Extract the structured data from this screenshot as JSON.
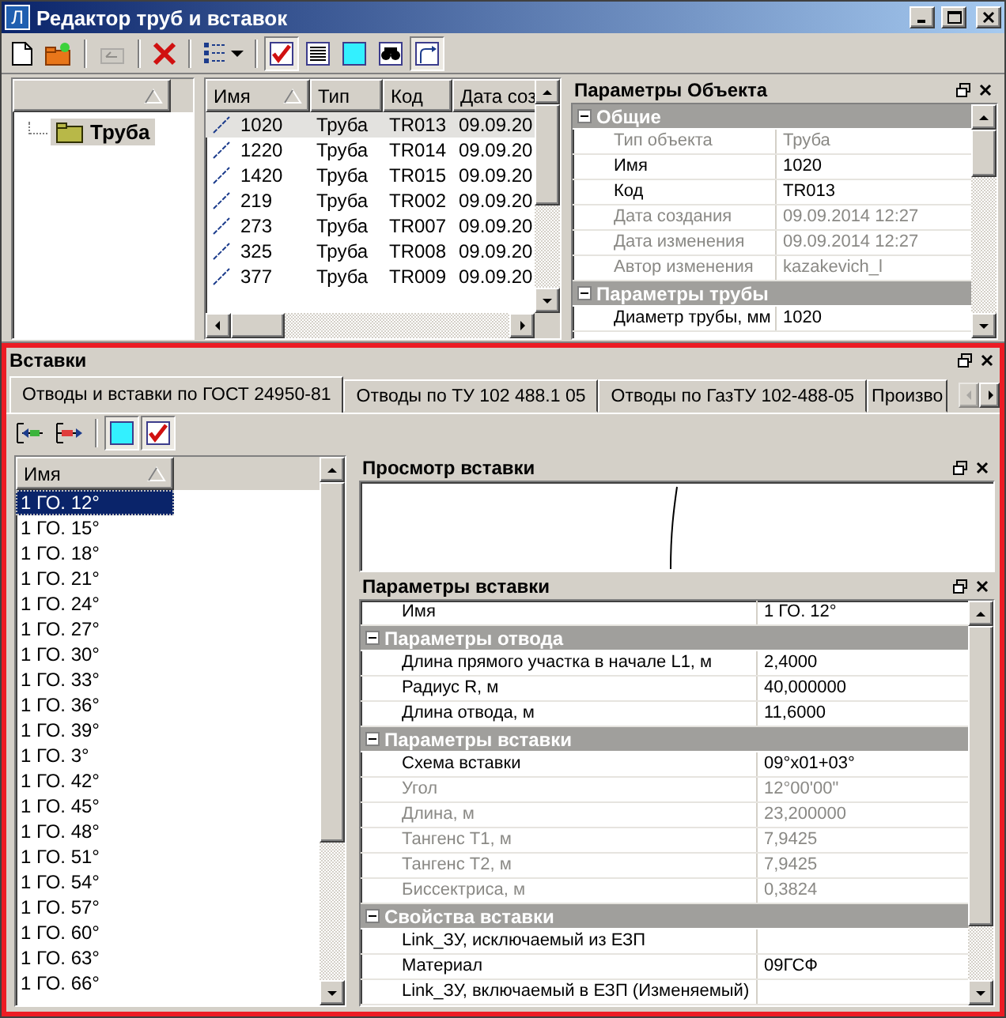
{
  "window": {
    "logo": "Л",
    "title": "Редактор труб и вставок"
  },
  "toolbar": [
    {
      "kind": "button",
      "pressed": false,
      "disabled": false
    },
    {
      "kind": "button",
      "pressed": false,
      "disabled": false
    },
    {
      "kind": "separator"
    },
    {
      "kind": "button",
      "pressed": false,
      "disabled": true
    },
    {
      "kind": "separator"
    },
    {
      "kind": "button",
      "pressed": false,
      "disabled": false
    },
    {
      "kind": "separator"
    },
    {
      "kind": "dropdown",
      "pressed": false,
      "disabled": false
    },
    {
      "kind": "separator"
    },
    {
      "kind": "button",
      "pressed": true,
      "disabled": false
    },
    {
      "kind": "button",
      "pressed": false,
      "disabled": false
    },
    {
      "kind": "button",
      "pressed": false,
      "disabled": false
    },
    {
      "kind": "button",
      "pressed": false,
      "disabled": false
    },
    {
      "kind": "button",
      "pressed": true,
      "disabled": false
    }
  ],
  "tree": {
    "items": [
      {
        "label": "Труба",
        "selected": true
      }
    ]
  },
  "pipes": {
    "columns": [
      "Имя",
      "Тип",
      "Код",
      "Дата соз"
    ],
    "rows": [
      {
        "cells": [
          "1020",
          "Труба",
          "TR013",
          "09.09.20"
        ],
        "selected": true
      },
      {
        "cells": [
          "1220",
          "Труба",
          "TR014",
          "09.09.20"
        ],
        "selected": false
      },
      {
        "cells": [
          "1420",
          "Труба",
          "TR015",
          "09.09.20"
        ],
        "selected": false
      },
      {
        "cells": [
          "219",
          "Труба",
          "TR002",
          "09.09.20"
        ],
        "selected": false
      },
      {
        "cells": [
          "273",
          "Труба",
          "TR007",
          "09.09.20"
        ],
        "selected": false
      },
      {
        "cells": [
          "325",
          "Труба",
          "TR008",
          "09.09.20"
        ],
        "selected": false
      },
      {
        "cells": [
          "377",
          "Труба",
          "TR009",
          "09.09.20"
        ],
        "selected": false
      }
    ]
  },
  "object_params": {
    "title": "Параметры Объекта",
    "groups": [
      {
        "title": "Общие",
        "expanded": true,
        "rows": [
          {
            "name": "Тип объекта",
            "value": "Труба",
            "disabled": true
          },
          {
            "name": "Имя",
            "value": "1020",
            "disabled": false
          },
          {
            "name": "Код",
            "value": "TR013",
            "disabled": false
          },
          {
            "name": "Дата создания",
            "value": "09.09.2014 12:27",
            "disabled": true
          },
          {
            "name": "Дата изменения",
            "value": "09.09.2014 12:27",
            "disabled": true
          },
          {
            "name": "Автор изменения",
            "value": "kazakevich_l",
            "disabled": true
          }
        ]
      },
      {
        "title": "Параметры трубы",
        "expanded": true,
        "rows": [
          {
            "name": "Диаметр трубы, мм",
            "value": "1020",
            "disabled": false
          }
        ]
      }
    ]
  },
  "inserts": {
    "title": "Вставки",
    "tabs": [
      {
        "label": "Отводы и вставки по ГОСТ 24950-81",
        "selected": true
      },
      {
        "label": "Отводы по ТУ 102 488.1 05",
        "selected": false
      },
      {
        "label": "Отводы по ГазТУ 102-488-05",
        "selected": false
      },
      {
        "label": "Произво",
        "selected": false
      }
    ],
    "toolbar": [
      {
        "kind": "button",
        "pressed": false,
        "disabled": false
      },
      {
        "kind": "button",
        "pressed": false,
        "disabled": false
      },
      {
        "kind": "separator"
      },
      {
        "kind": "button",
        "pressed": true,
        "disabled": false
      },
      {
        "kind": "button",
        "pressed": true,
        "disabled": false
      }
    ],
    "list": {
      "column": "Имя",
      "items": [
        {
          "label": "1 ГО. 12°",
          "selected": true
        },
        {
          "label": "1 ГО. 15°",
          "selected": false
        },
        {
          "label": "1 ГО. 18°",
          "selected": false
        },
        {
          "label": "1 ГО. 21°",
          "selected": false
        },
        {
          "label": "1 ГО. 24°",
          "selected": false
        },
        {
          "label": "1 ГО. 27°",
          "selected": false
        },
        {
          "label": "1 ГО. 30°",
          "selected": false
        },
        {
          "label": "1 ГО. 33°",
          "selected": false
        },
        {
          "label": "1 ГО. 36°",
          "selected": false
        },
        {
          "label": "1 ГО. 39°",
          "selected": false
        },
        {
          "label": "1 ГО. 3°",
          "selected": false
        },
        {
          "label": "1 ГО. 42°",
          "selected": false
        },
        {
          "label": "1 ГО. 45°",
          "selected": false
        },
        {
          "label": "1 ГО. 48°",
          "selected": false
        },
        {
          "label": "1 ГО. 51°",
          "selected": false
        },
        {
          "label": "1 ГО. 54°",
          "selected": false
        },
        {
          "label": "1 ГО. 57°",
          "selected": false
        },
        {
          "label": "1 ГО. 60°",
          "selected": false
        },
        {
          "label": "1 ГО. 63°",
          "selected": false
        },
        {
          "label": "1 ГО. 66°",
          "selected": false
        }
      ]
    },
    "preview": {
      "title": "Просмотр вставки"
    },
    "params": {
      "title": "Параметры вставки",
      "rows": [
        {
          "name": "Имя",
          "value": "1 ГО. 12°",
          "disabled": false
        }
      ],
      "groups": [
        {
          "title": "Параметры отвода",
          "expanded": true,
          "rows": [
            {
              "name": "Длина прямого участка в начале L1, м",
              "value": "2,4000",
              "disabled": false
            },
            {
              "name": "Радиус R, м",
              "value": "40,000000",
              "disabled": false
            },
            {
              "name": "Длина отвода, м",
              "value": "11,6000",
              "disabled": false
            }
          ]
        },
        {
          "title": "Параметры вставки",
          "expanded": true,
          "rows": [
            {
              "name": "Схема вставки",
              "value": "09°x01+03°",
              "disabled": false
            },
            {
              "name": "Угол",
              "value": "  12°00'00\"",
              "disabled": true
            },
            {
              "name": "Длина, м",
              "value": "23,200000",
              "disabled": true
            },
            {
              "name": "Тангенс T1, м",
              "value": "7,9425",
              "disabled": true
            },
            {
              "name": "Тангенс T2, м",
              "value": "7,9425",
              "disabled": true
            },
            {
              "name": "Биссектриса, м",
              "value": "0,3824",
              "disabled": true
            }
          ]
        },
        {
          "title": "Свойства вставки",
          "expanded": true,
          "rows": [
            {
              "name": "Link_ЗУ, исключаемый из ЕЗП",
              "disabled": false
            },
            {
              "name": "Материал",
              "value": "09ГСФ",
              "disabled": false
            },
            {
              "name": "Link_ЗУ, включаемый в ЕЗП (Изменяемый)",
              "disabled": false
            }
          ]
        }
      ]
    }
  }
}
